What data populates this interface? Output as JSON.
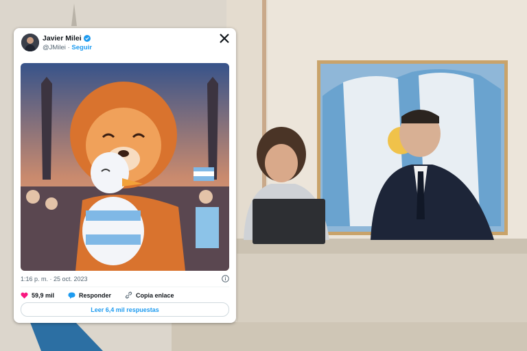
{
  "tweet": {
    "author_name": "Javier Milei",
    "handle": "@JMilei",
    "separator": "·",
    "follow_label": "Seguir",
    "timestamp": "1:16 p. m. · 25 oct. 2023",
    "likes_count": "59,9 mil",
    "reply_label": "Responder",
    "copy_link_label": "Copia enlace",
    "read_replies_label": "Leer 6,4 mil respuestas"
  },
  "icons": {
    "verified": "verified-badge-icon",
    "x_logo": "x-logo-icon",
    "info": "info-icon",
    "heart": "heart-icon",
    "reply": "reply-bubble-icon",
    "link": "link-icon"
  },
  "colors": {
    "accent": "#1d9bf0",
    "like": "#f91880",
    "text": "#0f1419",
    "muted": "#536471"
  }
}
